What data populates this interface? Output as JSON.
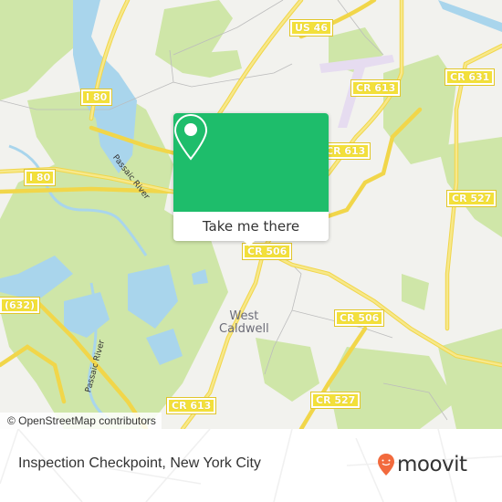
{
  "map": {
    "attribution": "© OpenStreetMap contributors",
    "road_labels": [
      {
        "id": "us46",
        "text": "US 46"
      },
      {
        "id": "i80-top",
        "text": "I 80"
      },
      {
        "id": "i80-left",
        "text": "I 80"
      },
      {
        "id": "cr613-top",
        "text": "CR 613"
      },
      {
        "id": "cr631",
        "text": "CR 631"
      },
      {
        "id": "cr613-mid",
        "text": "CR 613"
      },
      {
        "id": "cr527-right",
        "text": "CR 527"
      },
      {
        "id": "cr506-center",
        "text": "CR 506"
      },
      {
        "id": "cr506-right",
        "text": "CR 506"
      },
      {
        "id": "cr632",
        "text": "(632)"
      },
      {
        "id": "cr613-bottom",
        "text": "CR 613"
      },
      {
        "id": "cr527-bottom",
        "text": "CR 527"
      }
    ],
    "place_labels": {
      "town_line1": "West",
      "town_line2": "Caldwell"
    },
    "river_labels": [
      {
        "id": "passaic-top",
        "text": "Passaic River"
      },
      {
        "id": "passaic-bottom",
        "text": "Passaic River"
      }
    ],
    "colors": {
      "land": "#f2f2ee",
      "park": "#cfe6a8",
      "water": "#a9d5ec",
      "road": "#f7e271",
      "airport": "#e6dcf0"
    }
  },
  "popup": {
    "pin_icon": "map-pin-icon",
    "action_label": "Take me there",
    "color": "#1ebd6b"
  },
  "footer": {
    "title": "Inspection Checkpoint, New York City",
    "brand": "moovit",
    "brand_color": "#f26a3d"
  }
}
